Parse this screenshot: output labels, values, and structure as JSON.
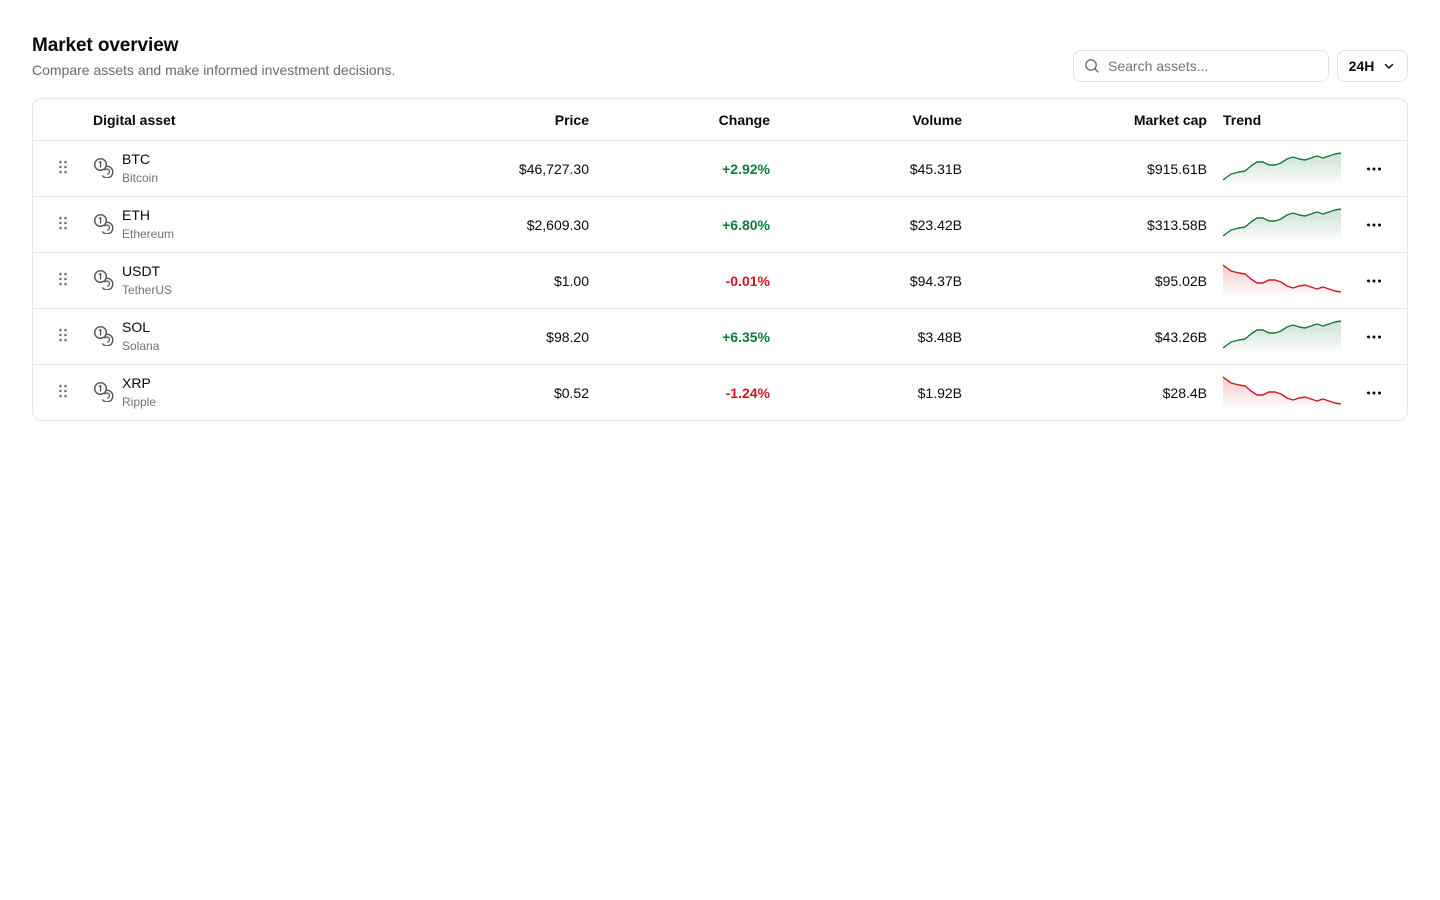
{
  "header": {
    "title": "Market overview",
    "subtitle": "Compare assets and make informed investment decisions."
  },
  "controls": {
    "search_placeholder": "Search assets...",
    "range_label": "24H"
  },
  "columns": {
    "asset": "Digital asset",
    "price": "Price",
    "change": "Change",
    "volume": "Volume",
    "market_cap": "Market cap",
    "trend": "Trend"
  },
  "colors": {
    "positive": "#0f7a3d",
    "negative": "#d0141f"
  },
  "assets": [
    {
      "symbol": "BTC",
      "name": "Bitcoin",
      "price": "$46,727.30",
      "change": "+2.92%",
      "direction": "up",
      "volume": "$45.31B",
      "market_cap": "$915.61B"
    },
    {
      "symbol": "ETH",
      "name": "Ethereum",
      "price": "$2,609.30",
      "change": "+6.80%",
      "direction": "up",
      "volume": "$23.42B",
      "market_cap": "$313.58B"
    },
    {
      "symbol": "USDT",
      "name": "TetherUS",
      "price": "$1.00",
      "change": "-0.01%",
      "direction": "down",
      "volume": "$94.37B",
      "market_cap": "$95.02B"
    },
    {
      "symbol": "SOL",
      "name": "Solana",
      "price": "$98.20",
      "change": "+6.35%",
      "direction": "up",
      "volume": "$3.48B",
      "market_cap": "$43.26B"
    },
    {
      "symbol": "XRP",
      "name": "Ripple",
      "price": "$0.52",
      "change": "-1.24%",
      "direction": "down",
      "volume": "$1.92B",
      "market_cap": "$28.4B"
    }
  ],
  "icons": {
    "search": "search-icon",
    "range_chevron": "chevron-down-icon",
    "drag": "grip-vertical-icon",
    "asset": "coins-icon",
    "more": "more-horizontal-icon"
  }
}
